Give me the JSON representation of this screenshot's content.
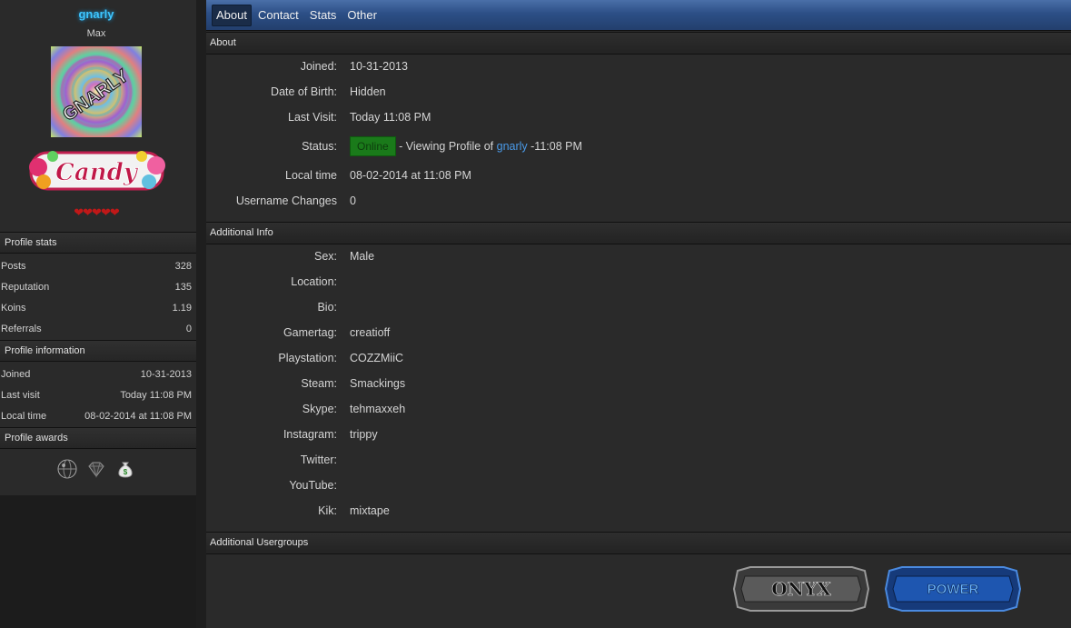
{
  "profile": {
    "username": "gnarly",
    "usertitle": "Max",
    "avatar_text": "GNARLY",
    "userbar_text": "Candy",
    "hearts": "❤❤❤❤❤"
  },
  "sidebar": {
    "stats_header": "Profile stats",
    "stats": [
      {
        "label": "Posts",
        "value": "328"
      },
      {
        "label": "Reputation",
        "value": "135"
      },
      {
        "label": "Koins",
        "value": "1.19"
      },
      {
        "label": "Referrals",
        "value": "0"
      }
    ],
    "info_header": "Profile information",
    "info": [
      {
        "label": "Joined",
        "value": "10-31-2013"
      },
      {
        "label": "Last visit",
        "value": "Today 11:08 PM"
      },
      {
        "label": "Local time",
        "value": "08-02-2014 at 11:08 PM"
      }
    ],
    "awards_header": "Profile awards",
    "awards": [
      "globe-award-icon",
      "diamond-award-icon",
      "money-bag-award-icon"
    ]
  },
  "tabs": [
    {
      "label": "About",
      "active": true
    },
    {
      "label": "Contact"
    },
    {
      "label": "Stats"
    },
    {
      "label": "Other"
    }
  ],
  "about": {
    "header": "About",
    "joined_label": "Joined:",
    "joined": "10-31-2013",
    "dob_label": "Date of Birth:",
    "dob": "Hidden",
    "last_visit_label": "Last Visit:",
    "last_visit": "Today 11:08 PM",
    "status_label": "Status:",
    "status_badge": "Online",
    "status_text_prefix": " - Viewing Profile of ",
    "status_user": "gnarly",
    "status_time": " -11:08 PM",
    "local_time_label": "Local time",
    "local_time": "08-02-2014 at 11:08 PM",
    "username_changes_label": "Username Changes",
    "username_changes": "0"
  },
  "additional": {
    "header": "Additional Info",
    "fields": [
      {
        "label": "Sex:",
        "value": "Male"
      },
      {
        "label": "Location:",
        "value": ""
      },
      {
        "label": "Bio:",
        "value": ""
      },
      {
        "label": "Gamertag:",
        "value": "creatioff"
      },
      {
        "label": "Playstation:",
        "value": "COZZMiiC"
      },
      {
        "label": "Steam:",
        "value": "Smackings"
      },
      {
        "label": "Skype:",
        "value": "tehmaxxeh"
      },
      {
        "label": "Instagram:",
        "value": "trippy"
      },
      {
        "label": "Twitter:",
        "value": ""
      },
      {
        "label": "YouTube:",
        "value": ""
      },
      {
        "label": "Kik:",
        "value": "mixtape"
      }
    ]
  },
  "usergroups": {
    "header": "Additional Usergroups",
    "groups": [
      "ONYX",
      "POWER"
    ]
  },
  "colors": {
    "accent": "#3ec6ff",
    "link": "#4a9ae8",
    "online": "#1a7a1a",
    "nav": "#2c4f86"
  }
}
